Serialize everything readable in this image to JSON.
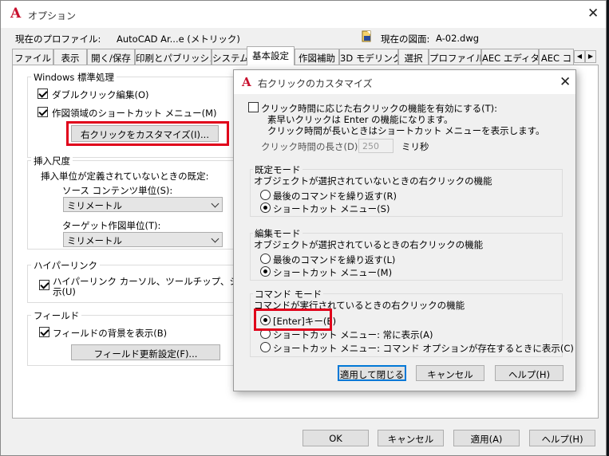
{
  "main_dialog": {
    "title": "オプション",
    "current_profile_label": "現在のプロファイル:",
    "current_profile_value": "AutoCAD Ar...e (メトリック)",
    "current_drawing_label": "現在の図面:",
    "current_drawing_value": "A-02.dwg",
    "tabs": [
      {
        "label": "ファイル"
      },
      {
        "label": "表示"
      },
      {
        "label": "開く/保存"
      },
      {
        "label": "印刷とパブリッシュ"
      },
      {
        "label": "システム"
      },
      {
        "label": "基本設定"
      },
      {
        "label": "作図補助"
      },
      {
        "label": "3D モデリング"
      },
      {
        "label": "選択"
      },
      {
        "label": "プロファイル"
      },
      {
        "label": "AEC エディタ"
      },
      {
        "label": "AEC コ"
      }
    ],
    "windows_group": {
      "title": "Windows 標準処理",
      "double_click_edit": "ダブルクリック編集(O)",
      "shortcut_menu": "作図領域のショートカット メニュー(M)",
      "customize_button": "右クリックをカスタマイズ(I)..."
    },
    "insert_scale_group": {
      "title": "挿入尺度",
      "desc": "挿入単位が定義されていないときの既定:",
      "source_label": "ソース コンテンツ単位(S):",
      "source_value": "ミリメートル",
      "target_label": "ターゲット作図単位(T):",
      "target_value": "ミリメートル"
    },
    "hyperlink_group": {
      "title": "ハイパーリンク",
      "checkbox_label_1": "ハイパーリンク カーソル、ツールチップ、ショートカット",
      "checkbox_label_2": "示(U)"
    },
    "field_group": {
      "title": "フィールド",
      "background_label": "フィールドの背景を表示(B)",
      "update_button": "フィールド更新設定(F)..."
    },
    "buttons": {
      "ok": "OK",
      "cancel": "キャンセル",
      "apply": "適用(A)",
      "help": "ヘルプ(H)"
    }
  },
  "rc_dialog": {
    "title": "右クリックのカスタマイズ",
    "timesensitive_label": "クリック時間に応じた右クリックの機能を有効にする(T):",
    "timesensitive_desc1": "素早いクリックは Enter の機能になります。",
    "timesensitive_desc2": "クリック時間が長いときはショートカット メニューを表示します。",
    "duration_label": "クリック時間の長さ(D):",
    "duration_value": "250",
    "duration_unit": "ミリ秒",
    "default_mode": {
      "title": "既定モード",
      "desc": "オブジェクトが選択されていないときの右クリックの機能",
      "opt1": "最後のコマンドを繰り返す(R)",
      "opt2": "ショートカット メニュー(S)"
    },
    "edit_mode": {
      "title": "編集モード",
      "desc": "オブジェクトが選択されているときの右クリックの機能",
      "opt1": "最後のコマンドを繰り返す(L)",
      "opt2": "ショートカット メニュー(M)"
    },
    "command_mode": {
      "title": "コマンド モード",
      "desc": "コマンドが実行されているときの右クリックの機能",
      "opt1": "[Enter]キー(E)",
      "opt2": "ショートカット メニュー: 常に表示(A)",
      "opt3": "ショートカット メニュー: コマンド オプションが存在するときに表示(C)"
    },
    "buttons": {
      "apply_close": "適用して閉じる",
      "cancel": "キャンセル",
      "help": "ヘルプ(H)"
    }
  },
  "colors": {
    "highlight": "#e0001a",
    "logo": "#c8102e",
    "focus": "#0078d7"
  }
}
